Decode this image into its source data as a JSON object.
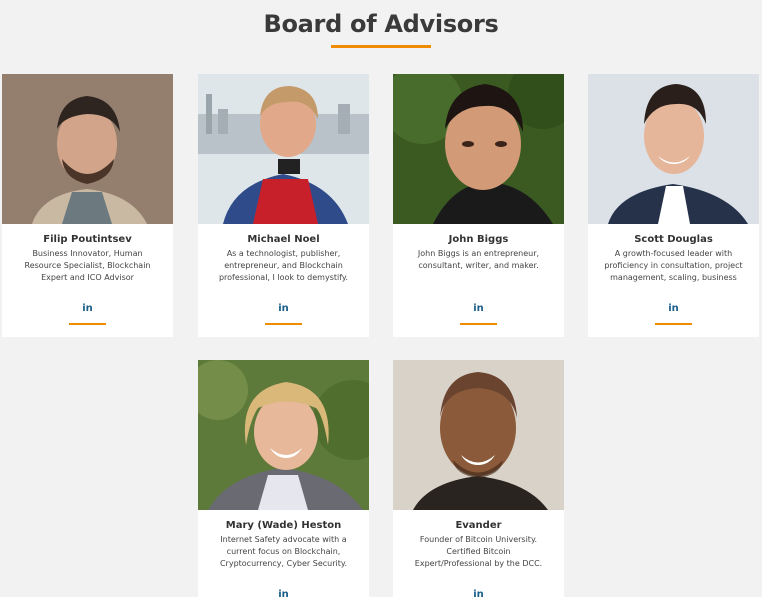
{
  "page": {
    "title": "Board of Advisors"
  },
  "advisors": [
    {
      "name": "Filip Poutintsev",
      "bio": "Business Innovator, Human Resource Specialist, Blockchain Expert and ICO Advisor",
      "link_label": "in"
    },
    {
      "name": "Michael Noel",
      "bio": "As a technologist, publisher, entrepreneur, and Blockchain professional, I look to demystify.",
      "link_label": "in"
    },
    {
      "name": "John Biggs",
      "bio": "John Biggs is an entrepreneur, consultant, writer, and maker.",
      "link_label": "in"
    },
    {
      "name": "Scott Douglas",
      "bio": "A growth-focused leader with proficiency in consultation, project management, scaling, business",
      "link_label": "in"
    },
    {
      "name": "Mary (Wade) Heston",
      "bio": "Internet Safety advocate with a current focus on Blockchain, Cryptocurrency, Cyber Security.",
      "link_label": "in"
    },
    {
      "name": "Evander",
      "bio": "Founder of Bitcoin University. Certified Bitcoin Expert/Professional by the DCC.",
      "link_label": "in"
    }
  ],
  "colors": {
    "accent": "#f08c00",
    "link": "#1a5e8a",
    "background": "#f2f2f2"
  }
}
